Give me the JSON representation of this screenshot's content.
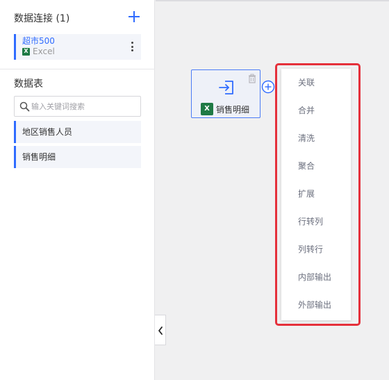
{
  "sidebar": {
    "connections_title": "数据连接 (1)",
    "connection": {
      "name": "超市500",
      "type": "Excel"
    },
    "tables_title": "数据表",
    "search": {
      "placeholder": "输入关键词搜索",
      "value": ""
    },
    "tables": [
      {
        "label": "地区销售人员"
      },
      {
        "label": "销售明细"
      }
    ]
  },
  "canvas": {
    "node": {
      "label": "销售明细",
      "icon": "import-icon",
      "type_icon": "excel-icon",
      "type_icon_letter": "X"
    }
  },
  "menu": {
    "items": [
      {
        "label": "关联"
      },
      {
        "label": "合并"
      },
      {
        "label": "清洗"
      },
      {
        "label": "聚合"
      },
      {
        "label": "扩展"
      },
      {
        "label": "行转列"
      },
      {
        "label": "列转行"
      },
      {
        "label": "内部输出"
      },
      {
        "label": "外部输出"
      }
    ]
  },
  "colors": {
    "accent": "#2f6bff",
    "highlight_border": "#e5303b",
    "excel_green": "#1f7a45"
  }
}
